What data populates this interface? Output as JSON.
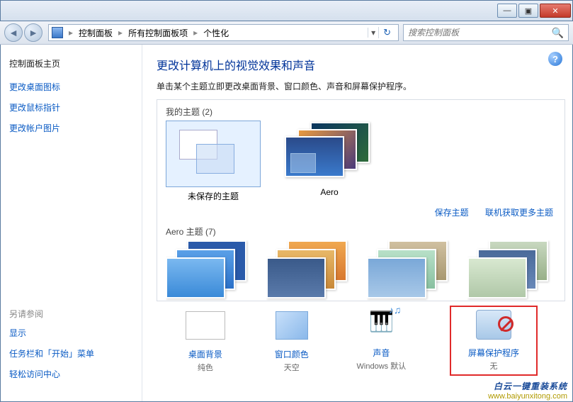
{
  "titlebar": {
    "min": "—",
    "max": "▣",
    "close": "✕"
  },
  "nav": {
    "crumbs": [
      "控制面板",
      "所有控制面板项",
      "个性化"
    ],
    "search_placeholder": "搜索控制面板"
  },
  "sidebar": {
    "home": "控制面板主页",
    "links": [
      "更改桌面图标",
      "更改鼠标指针",
      "更改帐户图片"
    ],
    "see_also_label": "另请参阅",
    "see_also": [
      "显示",
      "任务栏和「开始」菜单",
      "轻松访问中心"
    ]
  },
  "main": {
    "title": "更改计算机上的视觉效果和声音",
    "desc": "单击某个主题立即更改桌面背景、窗口颜色、声音和屏幕保护程序。",
    "my_themes_label": "我的主题 (2)",
    "themes": {
      "unsaved": "未保存的主题",
      "aero": "Aero"
    },
    "actions": {
      "save": "保存主题",
      "online": "联机获取更多主题"
    },
    "aero_themes_label": "Aero 主题 (7)"
  },
  "bottom": {
    "bg": {
      "label": "桌面背景",
      "value": "纯色"
    },
    "color": {
      "label": "窗口颜色",
      "value": "天空"
    },
    "sound": {
      "label": "声音",
      "value": "Windows 默认"
    },
    "saver": {
      "label": "屏幕保护程序",
      "value": "无"
    }
  },
  "watermark": {
    "l1": "白云一键重装系统",
    "l2": "www.baiyunxitong.com"
  }
}
